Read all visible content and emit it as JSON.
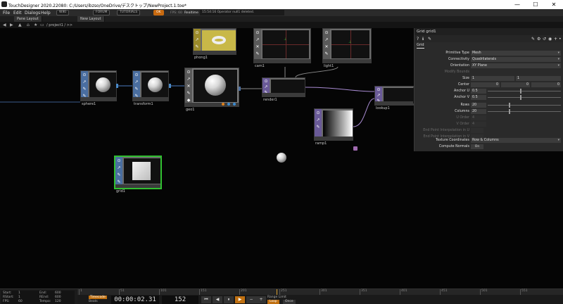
{
  "window": {
    "title": "TouchDesigner 2020.22080: C:/Users/ibzso/OneDrive/デスクトップ/NewProject.1.toe*",
    "minimize": "—",
    "maximize": "☐",
    "close": "✕"
  },
  "menu": {
    "items": [
      "File",
      "Edit",
      "Dialogs",
      "Help"
    ],
    "pills": [
      "WIKI",
      "FORUM",
      "TUTORIALS",
      "OK"
    ],
    "fps": "FPS: 60",
    "realtime": "Realtime",
    "status": "15:54:16 Operator null1 deleted."
  },
  "tabs": [
    "Pane Layout",
    "New Layout"
  ],
  "path": {
    "text": "/ project1 / >>"
  },
  "network": {
    "nodes": [
      {
        "id": "sphere1",
        "label": "sphere1",
        "family": "SOP"
      },
      {
        "id": "transform1",
        "label": "transform1",
        "family": "SOP"
      },
      {
        "id": "geo1",
        "label": "geo1",
        "family": "COMP"
      },
      {
        "id": "phong1",
        "label": "phong1",
        "family": "MAT"
      },
      {
        "id": "cam1",
        "label": "cam1",
        "family": "COMP"
      },
      {
        "id": "light1",
        "label": "light1",
        "family": "COMP"
      },
      {
        "id": "render1",
        "label": "render1",
        "family": "TOP"
      },
      {
        "id": "lookup1",
        "label": "lookup1",
        "family": "TOP"
      },
      {
        "id": "ramp1",
        "label": "ramp1",
        "family": "TOP"
      },
      {
        "id": "grid1",
        "label": "grid1",
        "family": "SOP",
        "selected": true
      }
    ]
  },
  "params": {
    "header": "Grid  grid1",
    "tab": "Grid",
    "rows": [
      {
        "label": "Primitive Type",
        "value": "Mesh",
        "kind": "dropdown"
      },
      {
        "label": "Connectivity",
        "value": "Quadrilaterals",
        "kind": "dropdown"
      },
      {
        "label": "Orientation",
        "value": "XY Plane",
        "kind": "dropdown"
      },
      {
        "label": "Modify Bounds",
        "value": "",
        "kind": "disabled"
      },
      {
        "label": "Size",
        "value": "1",
        "value2": "1",
        "kind": "pair"
      },
      {
        "label": "Center",
        "value": "0",
        "value2": "0",
        "value3": "0",
        "kind": "triple"
      },
      {
        "label": "Anchor U",
        "value": "0.5",
        "kind": "slider"
      },
      {
        "label": "Anchor V",
        "value": "0.5",
        "kind": "slider"
      },
      {
        "label": "Rows",
        "value": "20",
        "kind": "slider"
      },
      {
        "label": "Columns",
        "value": "20",
        "kind": "slider"
      },
      {
        "label": "U Order",
        "value": "4",
        "kind": "disabled"
      },
      {
        "label": "V Order",
        "value": "4",
        "kind": "disabled"
      },
      {
        "label": "End Point Interpolation in U",
        "value": "",
        "kind": "disabled"
      },
      {
        "label": "End Point Interpolation in V",
        "value": "",
        "kind": "disabled"
      },
      {
        "label": "Texture Coordinates",
        "value": "Row & Columns",
        "kind": "dropdown"
      },
      {
        "label": "Compute Normals",
        "value": "On",
        "kind": "toggle"
      }
    ]
  },
  "timeline": {
    "info": {
      "start_label": "Start:",
      "start": "1",
      "end_label": "End:",
      "end": "600",
      "rstart_label": "RStart:",
      "rstart": "1",
      "rend_label": "REnd:",
      "rend": "600",
      "fps_label": "FPS:",
      "fps": "60",
      "tempo_label": "Tempo:",
      "tempo": "120"
    },
    "ticks": [
      "1",
      "51",
      "101",
      "151",
      "201",
      "251",
      "301",
      "351",
      "401",
      "451",
      "501",
      "551"
    ],
    "timecode_tag": "Timecode",
    "beats_label": "Beats",
    "timecode": "00:00:02.31",
    "frame": "152",
    "buttons": [
      "⏮",
      "◀",
      "⏸",
      "▶",
      "−",
      "+"
    ],
    "range_label": "Range Limit",
    "range_loop": "Loop",
    "range_once": "Once"
  },
  "colors": {
    "sop": "#4a6ea0",
    "top": "#6a5a98",
    "mat": "#9a8a2a",
    "selected": "#30c030",
    "accent": "#c07010"
  }
}
